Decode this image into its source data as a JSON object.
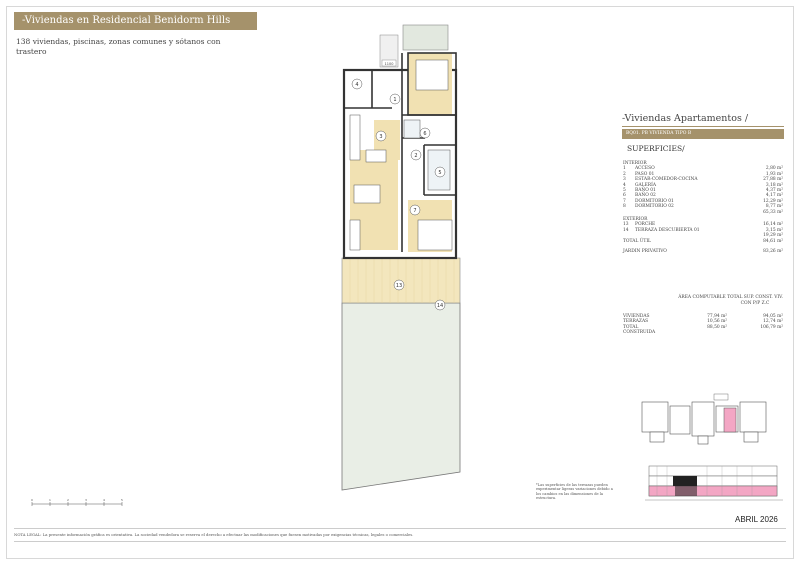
{
  "header": {
    "title": "-Viviendas en Residencial Benidorm Hills",
    "intro": "138 viviendas, piscinas, zonas comunes y sótanos con trastero"
  },
  "section": {
    "title": "-Viviendas Apartamentos /",
    "tag": "BQ01. PB   VIVIENDA TIPO B",
    "superficies_title": "SUPERFICIES/"
  },
  "interior": {
    "heading": "INTERIOR",
    "rows": [
      {
        "n": "1",
        "label": "ACCESO",
        "value": "2,80 m²"
      },
      {
        "n": "2",
        "label": "PASO 01",
        "value": "1,93 m²"
      },
      {
        "n": "3",
        "label": "ESTAR-COMEDOR-COCINA",
        "value": "27,88 m²"
      },
      {
        "n": "4",
        "label": "GALERÍA",
        "value": "3,18 m²"
      },
      {
        "n": "5",
        "label": "BAÑO 01",
        "value": "4,37 m²"
      },
      {
        "n": "6",
        "label": "BAÑO 02",
        "value": "4,17 m²"
      },
      {
        "n": "7",
        "label": "DORMITORIO 01",
        "value": "12,29 m²"
      },
      {
        "n": "8",
        "label": "DORMITORIO 02",
        "value": "8,77 m²"
      }
    ],
    "subtotal": "65,33 m²"
  },
  "exterior": {
    "heading": "EXTERIOR",
    "rows": [
      {
        "n": "13",
        "label": "PORCHE",
        "value": "16,14 m²"
      },
      {
        "n": "14",
        "label": "TERRAZA DESCUBIERTA 01",
        "value": "3,15 m²"
      }
    ],
    "subtotal": "19,29 m²"
  },
  "totals": {
    "total_util_label": "TOTAL ÚTIL",
    "total_util_value": "84,61 m²",
    "jardin_label": "JARDIN PRIVATIVO",
    "jardin_value": "83,26 m²"
  },
  "summary": {
    "col_area": "ÁREA COMPUTABLE",
    "col_total": "TOTAL SUP. CONST. VIV. CON P/P Z.C",
    "rows": [
      {
        "label": "VIVIENDAS",
        "area": "77,94 m²",
        "total": "94,05 m²"
      },
      {
        "label": "TERRAZAS",
        "area": "10,56 m²",
        "total": "12,74 m²"
      },
      {
        "label": "TOTAL CONSTRUIDA",
        "area": "88,50 m²",
        "total": "106,79 m²"
      }
    ]
  },
  "footnote": "*Las superficies de las terrazas pueden experimentar ligeras variaciones debido a los cambios en las dimensiones de la estructura.",
  "legal": "NOTA LEGAL: La presente información gráfica es orientativa. La sociedad vendedora se reserva el derecho a efectuar las modificaciones que fuesen motivadas por exigencias técnicas, legales o comerciales.",
  "date": "ABRIL 2026",
  "plan": {
    "rooms": [
      "1",
      "2",
      "3",
      "4",
      "5",
      "6",
      "7",
      "13",
      "14"
    ],
    "door_label": "1100"
  },
  "scale_ticks": [
    "0",
    "1",
    "2",
    "3",
    "4",
    "5"
  ],
  "colors": {
    "gold": "#a5926b",
    "wood": "#f1e1b2",
    "garden": "#e9eee6",
    "keyplan_highlight": "#f3a6c4"
  }
}
